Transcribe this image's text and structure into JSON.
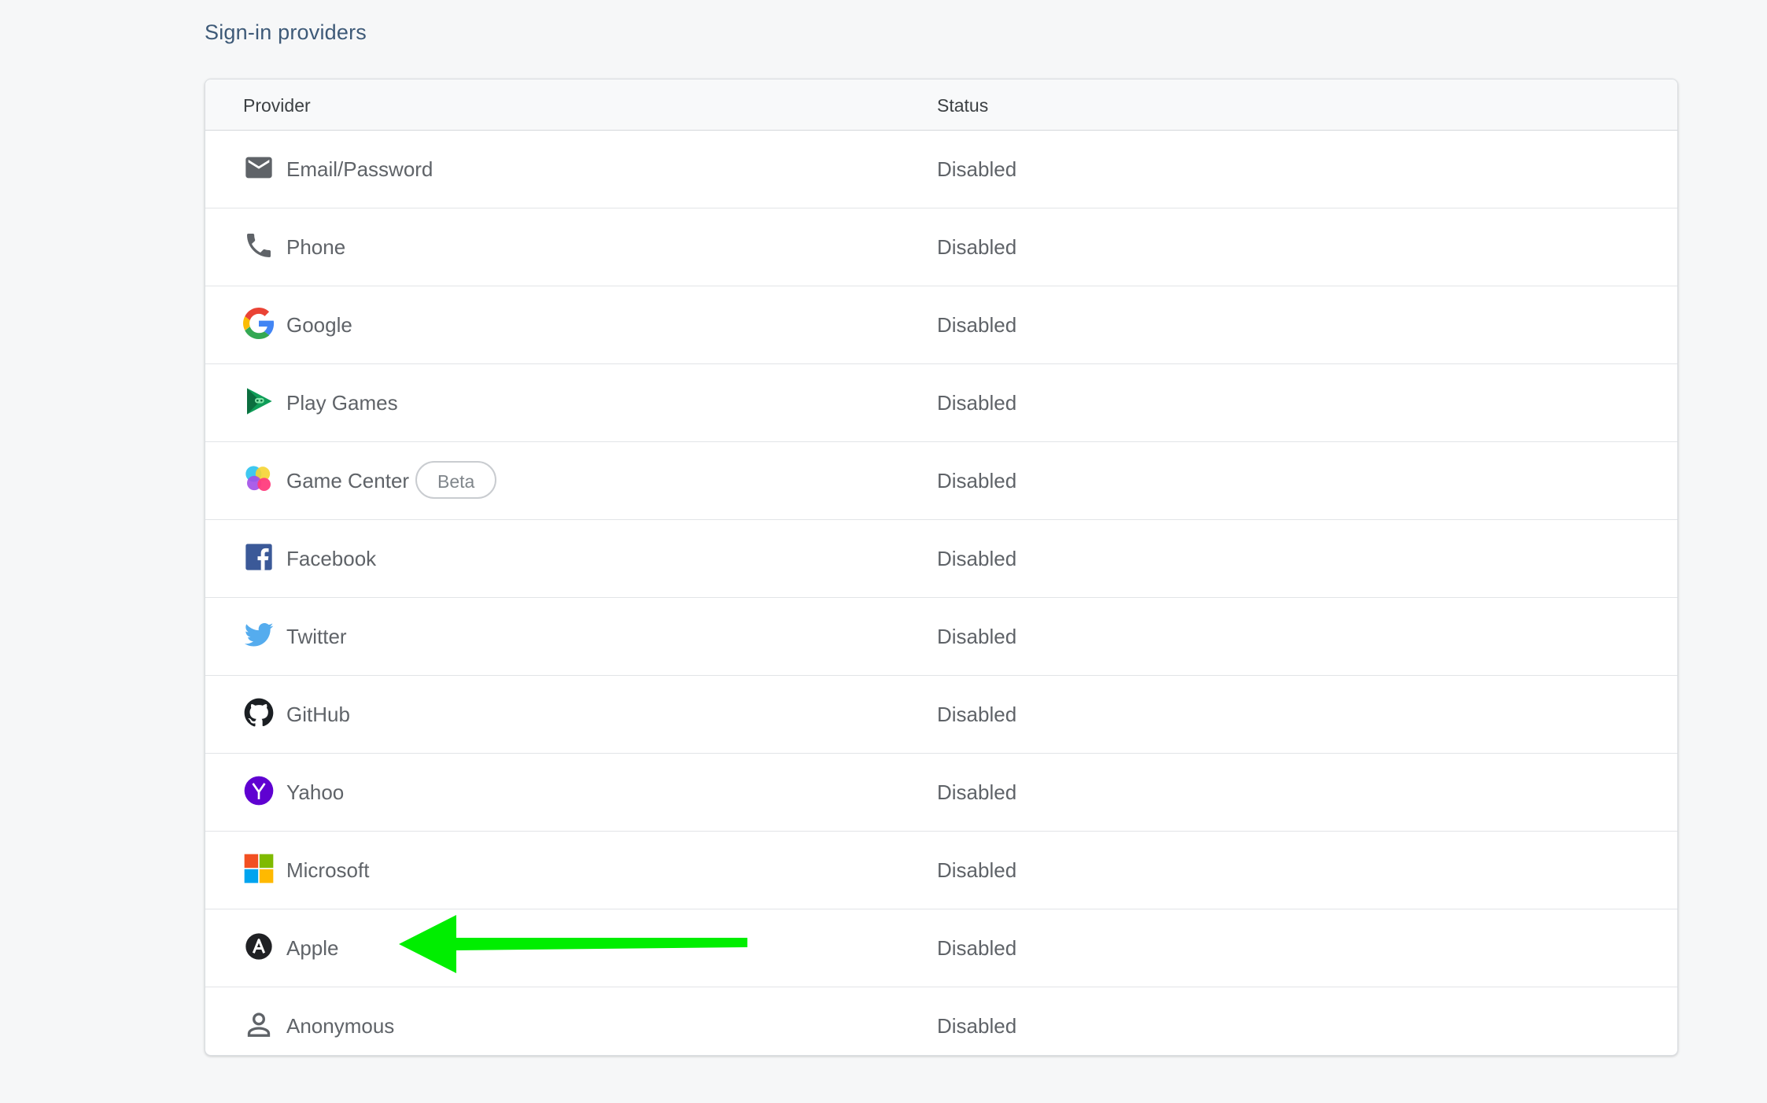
{
  "section_title": "Sign-in providers",
  "table": {
    "headers": {
      "provider": "Provider",
      "status": "Status"
    },
    "rows": [
      {
        "name": "Email/Password",
        "icon": "email-icon",
        "status": "Disabled"
      },
      {
        "name": "Phone",
        "icon": "phone-icon",
        "status": "Disabled"
      },
      {
        "name": "Google",
        "icon": "google-icon",
        "status": "Disabled"
      },
      {
        "name": "Play Games",
        "icon": "play-games-icon",
        "status": "Disabled"
      },
      {
        "name": "Game Center",
        "icon": "game-center-icon",
        "status": "Disabled",
        "badge": "Beta"
      },
      {
        "name": "Facebook",
        "icon": "facebook-icon",
        "status": "Disabled"
      },
      {
        "name": "Twitter",
        "icon": "twitter-icon",
        "status": "Disabled"
      },
      {
        "name": "GitHub",
        "icon": "github-icon",
        "status": "Disabled"
      },
      {
        "name": "Yahoo",
        "icon": "yahoo-icon",
        "status": "Disabled"
      },
      {
        "name": "Microsoft",
        "icon": "microsoft-icon",
        "status": "Disabled"
      },
      {
        "name": "Apple",
        "icon": "apple-icon",
        "status": "Disabled"
      },
      {
        "name": "Anonymous",
        "icon": "anonymous-icon",
        "status": "Disabled"
      }
    ]
  },
  "annotation": {
    "icon": "green-arrow-icon",
    "color": "#00ee00",
    "points_to": "Apple"
  },
  "colors": {
    "section_title": "#3e5a78",
    "text": "#5f6368",
    "background": "#f6f7f8",
    "card": "#ffffff"
  }
}
